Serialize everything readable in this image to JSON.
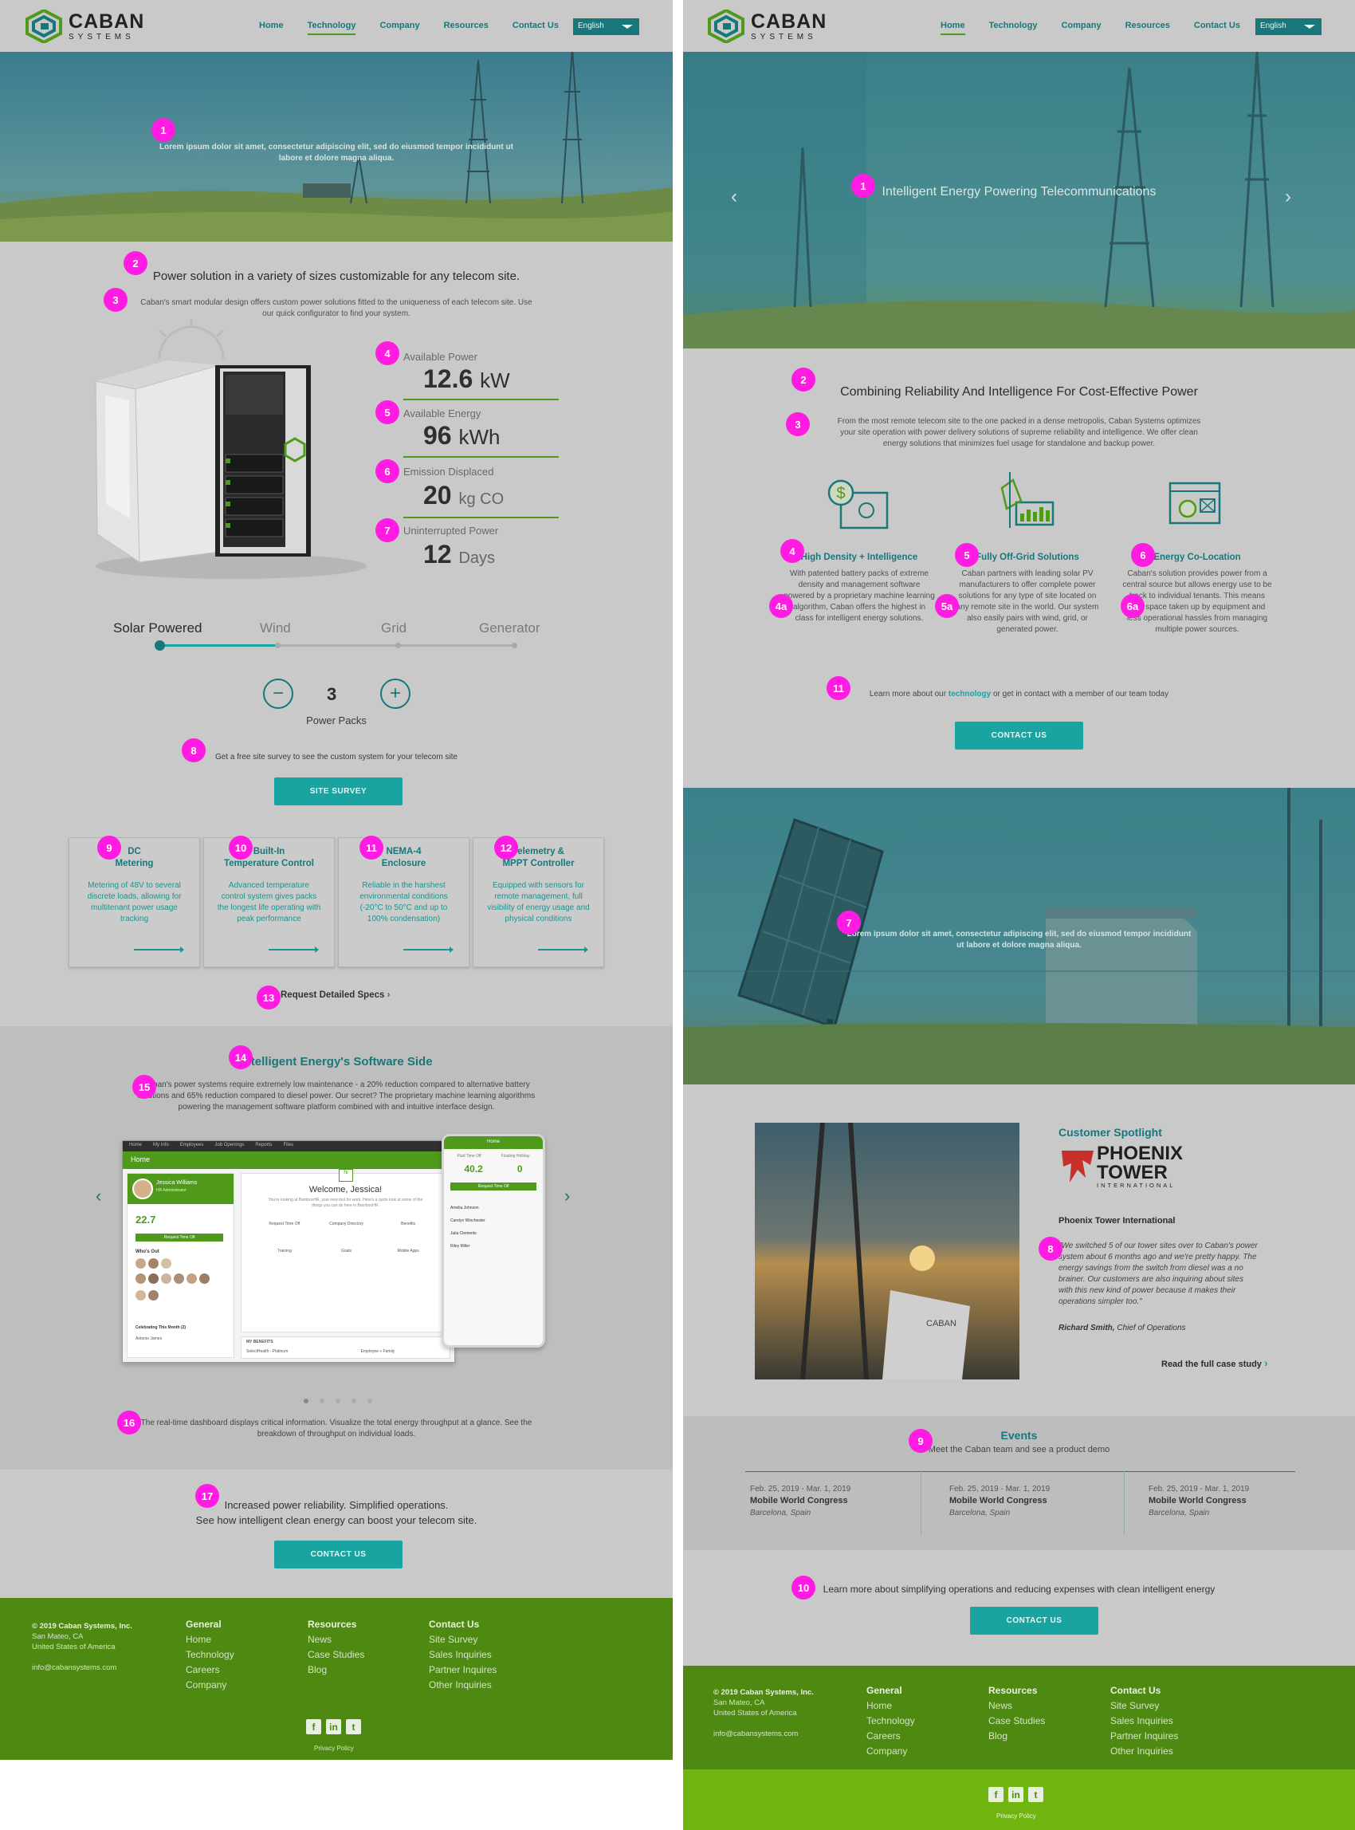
{
  "brand": {
    "name": "CABAN",
    "sub": "SYSTEMS"
  },
  "nav": {
    "items": [
      "Home",
      "Technology",
      "Company",
      "Resources",
      "Contact Us"
    ],
    "language": "English"
  },
  "markers_a": [
    "1",
    "2",
    "3",
    "4",
    "5",
    "6",
    "7",
    "8",
    "9",
    "10",
    "11",
    "12",
    "13",
    "14",
    "15",
    "16",
    "17"
  ],
  "markers_b": [
    "1",
    "2",
    "3",
    "4",
    "5",
    "6",
    "4a",
    "5a",
    "6a",
    "11",
    "7",
    "8",
    "9",
    "10"
  ],
  "technology_page": {
    "hero_text": "Lorem ipsum dolor sit amet, consectetur adipiscing elit, sed do eiusmod tempor incididunt ut labore et dolore magna aliqua.",
    "heading": "Power solution in a variety of sizes customizable for any telecom site.",
    "subtext": "Caban's smart modular design offers custom power solutions fitted to the uniqueness of each telecom site. Use our quick configurator to find your system.",
    "stats": [
      {
        "label": "Available Power",
        "value": "12.6",
        "unit": "kW"
      },
      {
        "label": "Available Energy",
        "value": "96",
        "unit": "kWh"
      },
      {
        "label": "Emission Displaced",
        "value": "20",
        "unit": "kg CO"
      },
      {
        "label": "Uninterrupted Power",
        "value": "12",
        "unit": "Days"
      }
    ],
    "sources": [
      "Solar Powered",
      "Wind",
      "Grid",
      "Generator"
    ],
    "packs_count": "3",
    "packs_label": "Power Packs",
    "minus": "−",
    "plus": "+",
    "survey_text": "Get a free site survey to see the custom system for your telecom site",
    "survey_button": "SITE SURVEY",
    "features": [
      {
        "title": "DC\nMetering",
        "desc": "Metering of 48V to several discrete loads, allowing for multitenant power usage tracking"
      },
      {
        "title": "Built-In\nTemperature Control",
        "desc": "Advanced temperature control system gives packs the longest life operating with peak performance"
      },
      {
        "title": "NEMA-4\nEnclosure",
        "desc": "Reliable in the harshest environmental conditions (-20°C to 50°C and up to 100% condensation)"
      },
      {
        "title": "Telemetry &\nMPPT Controller",
        "desc": "Equipped with sensors for remote management, full visibility of energy usage and physical conditions"
      }
    ],
    "request_specs": "Request Detailed Specs",
    "software_title": "Intelligent Energy's Software Side",
    "software_text": "Caban's power systems require extremely low maintenance - a 20% reduction compared to alternative battery solutions and 65% reduction compared to diesel power. Our secret? The proprietary machine learning algorithms powering the management software platform combined with and intuitive interface design.",
    "dashboard": {
      "tabs": [
        "Home",
        "My Info",
        "Employees",
        "Job Openings",
        "Reports",
        "Files"
      ],
      "home": "Home",
      "user": "Jessica Williams",
      "role": "HR Administrator",
      "welcome": "Welcome, Jessica!",
      "intro": "You're looking at BambooHR, your new tool for work. Here's a quick look at some of the things you can do here in BambooHR.",
      "tiles": [
        "Request Time Off",
        "Company Directory",
        "Benefits",
        "Training",
        "Goals",
        "Mobile Apps"
      ],
      "metric1": "22.7",
      "metric2": "40.2",
      "metric3": "0",
      "request_button": "Request Time Off",
      "whos_out": "Who's Out",
      "celebrating": "Celebrating This Month (2)",
      "celebrant": "Antonio James",
      "my_benefits": "MY BENEFITS",
      "benefit_plan": "SelectHealth - Platinum",
      "benefit_cov": "Employee + Family",
      "phone_people": [
        "Amelia Johnson",
        "Carolyn Winchester",
        "Julia Clements",
        "Riley Miller"
      ],
      "time_off": "Paid Time Off",
      "floating": "Floating Holiday"
    },
    "carousel_prev": "‹",
    "carousel_next": "›",
    "dashboard_caption": "The real-time dashboard displays critical information. Visualize the total energy throughput at a glance. See the breakdown of throughput on individual loads.",
    "closing_line1": "Increased power reliability. Simplified operations.",
    "closing_line2": "See how intelligent clean energy can boost your telecom site.",
    "contact_button": "CONTACT US"
  },
  "home_page": {
    "hero_title": "Intelligent Energy Powering Telecommunications",
    "heading": "Combining Reliability And Intelligence For Cost-Effective Power",
    "subtext": "From the most remote telecom site to the one packed in a dense metropolis, Caban Systems optimizes your site operation with power delivery solutions of supreme reliability and intelligence. We offer clean energy solutions that minimizes fuel usage for standalone and backup power.",
    "features": [
      {
        "title": "High Density + Intelligence",
        "desc": "With patented battery packs of extreme density and management software powered by a proprietary machine learning algorithm, Caban offers the highest in class for intelligent energy solutions."
      },
      {
        "title": "Fully Off-Grid Solutions",
        "desc": "Caban partners with leading solar PV manufacturers to offer complete power solutions for any type of site located on any remote site in the world. Our system also easily pairs with wind, grid, or generated power."
      },
      {
        "title": "Energy Co-Location",
        "desc": "Caban's solution provides power from a central source but allows energy use to be track to individual tenants. This means less space taken up by equipment and less operational hassles from managing multiple power sources."
      }
    ],
    "learn_pre": "Learn more about our ",
    "learn_link": "technology",
    "learn_post": " or get in contact with a member of our team today",
    "contact_button": "CONTACT US",
    "hero2_text": "Lorem ipsum dolor sit amet, consectetur adipiscing elit, sed do eiusmod tempor incididunt ut labore et dolore magna aliqua.",
    "spotlight_title": "Customer Spotlight",
    "spotlight_logo_1": "PHOENIX",
    "spotlight_logo_2": "TOWER",
    "spotlight_logo_3": "INTERNATIONAL",
    "spotlight_company": "Phoenix Tower International",
    "spotlight_quote": "\"We switched 5 of our tower sites over to Caban's power system about 6 months ago and we're pretty happy. The energy savings from the switch from diesel was a no brainer. Our customers are also inquiring about sites with this new kind of power because it makes their operations simpler too.\"",
    "spotlight_author": "Richard Smith,",
    "spotlight_author_role": "Chief of Operations",
    "spotlight_link": "Read the full case study",
    "cabinet_label": "CABAN",
    "events_title": "Events",
    "events_sub": "Meet the Caban team and see a product demo",
    "events": [
      {
        "date": "Feb. 25, 2019 - Mar. 1, 2019",
        "name": "Mobile World Congress",
        "location": "Barcelona, Spain"
      },
      {
        "date": "Feb. 25, 2019 - Mar. 1, 2019",
        "name": "Mobile World Congress",
        "location": "Barcelona, Spain"
      },
      {
        "date": "Feb. 25, 2019 - Mar. 1, 2019",
        "name": "Mobile World Congress",
        "location": "Barcelona, Spain"
      }
    ],
    "closing": "Learn more about simplifying operations and reducing expenses with clean intelligent energy",
    "closing_button": "CONTACT US"
  },
  "footer": {
    "copyright": "© 2019 Caban Systems, Inc.",
    "city": "San Mateo, CA",
    "country": "United States of America",
    "email": "info@cabansystems.com",
    "columns": [
      {
        "title": "General",
        "links": [
          "Home",
          "Technology",
          "Careers",
          "Company"
        ]
      },
      {
        "title": "Resources",
        "links": [
          "News",
          "Case Studies",
          "Blog"
        ]
      },
      {
        "title": "Contact Us",
        "links": [
          "Site Survey",
          "Sales Inquiries",
          "Partner Inquires",
          "Other Inquiries"
        ]
      }
    ],
    "social": [
      "f",
      "in",
      "t"
    ],
    "privacy": "Privacy Policy"
  },
  "colors": {
    "teal": "#17777a",
    "green": "#4e8a12",
    "accent_button": "#19a3a1",
    "marker": "#ff1be2",
    "hero_tint": "#3b7d8c"
  },
  "icons": [
    "logo-icon",
    "caret-down-icon",
    "chevron-left-icon",
    "chevron-right-icon",
    "facebook-icon",
    "linkedin-icon",
    "twitter-icon",
    "dollar-safe-icon",
    "solar-chart-icon",
    "browser-network-icon"
  ]
}
